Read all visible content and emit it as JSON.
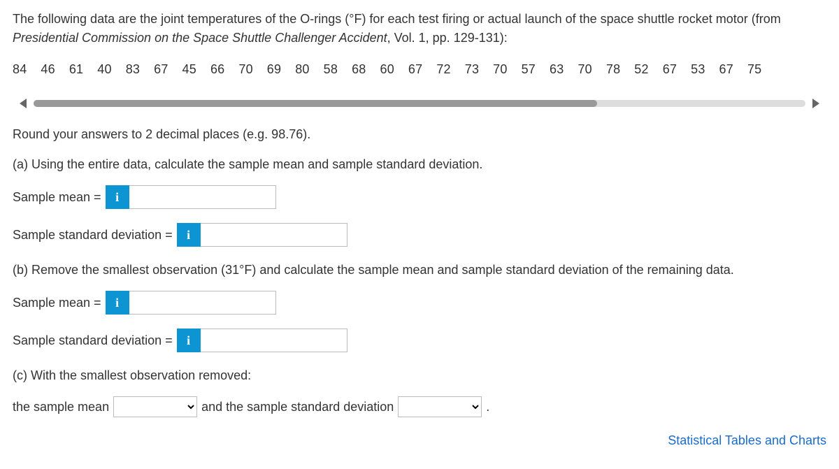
{
  "intro": {
    "part1": "The following data are the joint temperatures of the O-rings (°F) for each test firing or actual launch of the space shuttle rocket motor (from ",
    "italic": "Presidential Commission on the Space Shuttle Challenger Accident",
    "part2": ", Vol. 1, pp. 129-131):"
  },
  "data_values": [
    "84",
    "46",
    "61",
    "40",
    "83",
    "67",
    "45",
    "66",
    "70",
    "69",
    "80",
    "58",
    "68",
    "60",
    "67",
    "72",
    "73",
    "70",
    "57",
    "63",
    "70",
    "78",
    "52",
    "67",
    "53",
    "67",
    "75"
  ],
  "round_instr": "Round your answers to 2 decimal places (e.g. 98.76).",
  "part_a": {
    "prompt": "(a) Using the entire data, calculate the sample mean and sample standard deviation.",
    "mean_label": "Sample mean =",
    "sd_label": "Sample standard deviation ="
  },
  "part_b": {
    "prompt": "(b) Remove the smallest observation (31°F) and calculate the sample mean and sample standard deviation of the remaining data.",
    "mean_label": "Sample mean =",
    "sd_label": "Sample standard deviation ="
  },
  "part_c": {
    "prompt": "(c) With the smallest observation removed:",
    "lead": "the sample mean",
    "mid": "and the sample standard deviation",
    "tail": "."
  },
  "info_glyph": "i",
  "footer_link": "Statistical Tables and Charts"
}
